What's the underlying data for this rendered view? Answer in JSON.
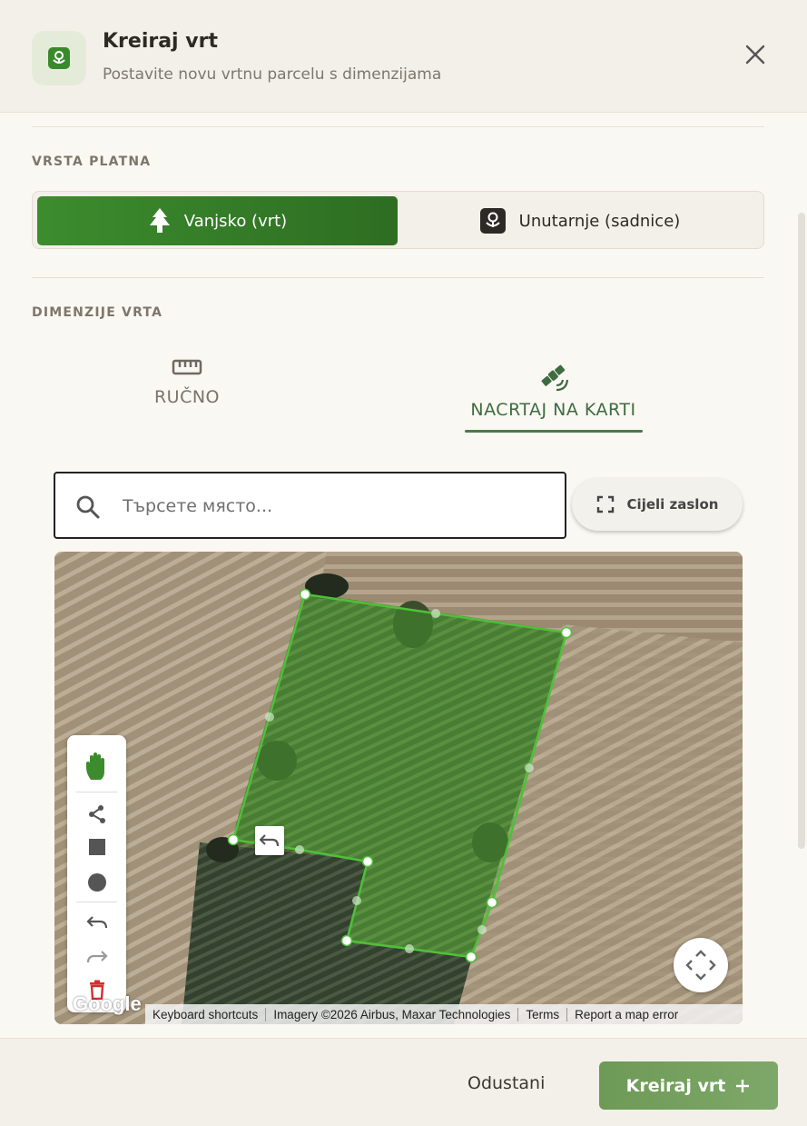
{
  "header": {
    "title": "Kreiraj vrt",
    "subtitle": "Postavite novu vrtnu parcelu s dimenzijama",
    "icon": "seedling-badge-icon"
  },
  "canvas_type": {
    "label": "VRSTA PLATNA",
    "options": [
      {
        "label": "Vanjsko (vrt)",
        "icon": "tree-icon",
        "selected": true
      },
      {
        "label": "Unutarnje (sadnice)",
        "icon": "seedling-badge-icon",
        "selected": false
      }
    ]
  },
  "dimensions": {
    "label": "DIMENZIJE VRTA",
    "tabs": [
      {
        "label": "RUČNO",
        "icon": "ruler-icon",
        "selected": false
      },
      {
        "label": "NACRTAJ NA KARTI",
        "icon": "satellite-icon",
        "selected": true
      }
    ]
  },
  "map": {
    "search_placeholder": "Търсете място...",
    "search_value": "",
    "fullscreen_label": "Cijeli zaslon",
    "google_logo": "Google",
    "attribution": [
      "Keyboard shortcuts",
      "Imagery ©2026 Airbus, Maxar Technologies",
      "Terms",
      "Report a map error"
    ],
    "tools": [
      "hand-icon",
      "polyline-icon",
      "rectangle-icon",
      "circle-icon",
      "undo-icon",
      "redo-icon",
      "trash-icon"
    ],
    "polygon_color": "#4fc03a"
  },
  "footer": {
    "cancel_label": "Odustani",
    "create_label": "Kreiraj vrt",
    "create_icon": "plus-icon"
  },
  "colors": {
    "accent": "#3c8c2e",
    "create_button": "#76a262",
    "tab_active": "#3f6b41"
  }
}
